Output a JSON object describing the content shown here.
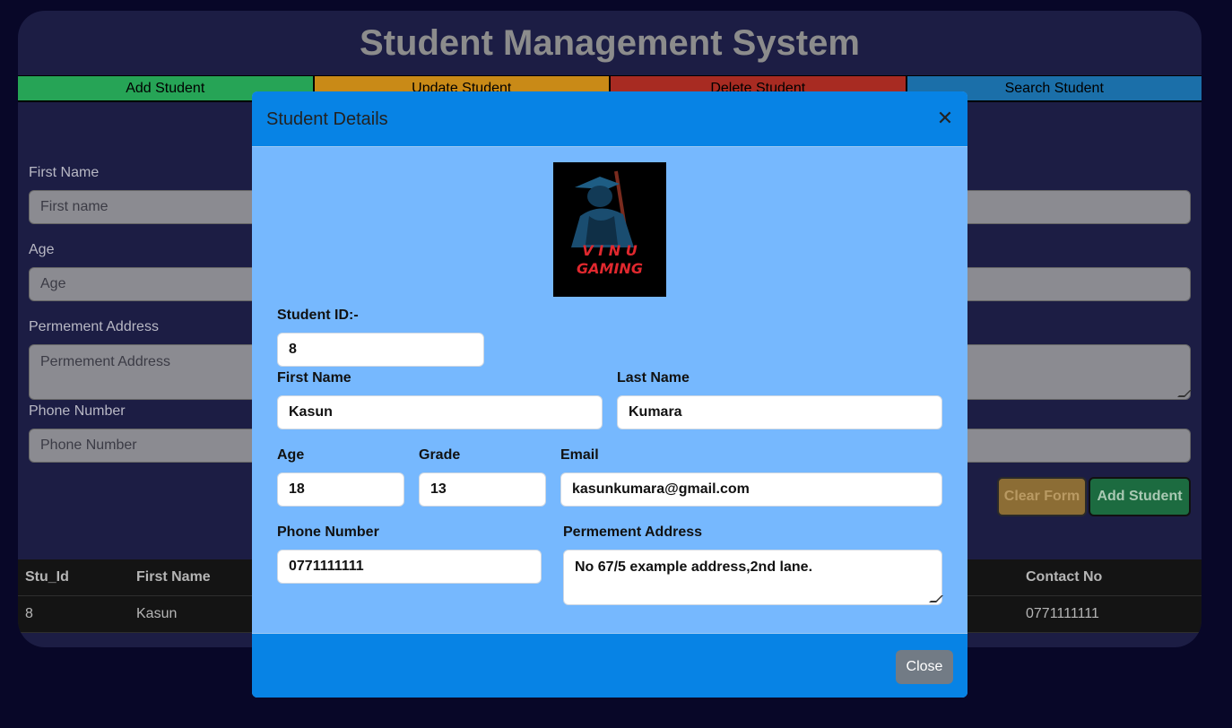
{
  "app": {
    "title": "Student Management System"
  },
  "tabs": [
    "Add Student",
    "Update Student",
    "Delete Student",
    "Search Student"
  ],
  "form": {
    "first_name_label": "First Name",
    "first_name_placeholder": "First name",
    "age_label": "Age",
    "age_placeholder": "Age",
    "address_label": "Permement Address",
    "address_placeholder": "Permement Address",
    "phone_label": "Phone Number",
    "phone_placeholder": "Phone Number",
    "clear_label": "Clear Form",
    "add_label": "Add Student"
  },
  "table": {
    "headers": {
      "id": "Stu_Id",
      "first": "First Name",
      "contact": "Contact No"
    },
    "rows": [
      {
        "id": "8",
        "first": "Kasun",
        "contact": "0771111111"
      }
    ]
  },
  "modal": {
    "title": "Student Details",
    "close_glyph": "✕",
    "logo_text": [
      "V I N U",
      "GAMING"
    ],
    "student_id_label": "Student ID:-",
    "student_id": "8",
    "first_name_label": "First Name",
    "first_name": "Kasun",
    "last_name_label": "Last Name",
    "last_name": "Kumara",
    "age_label": "Age",
    "age": "18",
    "grade_label": "Grade",
    "grade": "13",
    "email_label": "Email",
    "email": "kasunkumara@gmail.com",
    "phone_label": "Phone Number",
    "phone": "0771111111",
    "address_label": "Permement Address",
    "address": "No 67/5 example address,2nd lane.",
    "close_label": "Close"
  },
  "colors": {
    "background": "#080728",
    "panel": "#1c1d44",
    "modal_body": "#76b8fe",
    "modal_header": "#0783e5",
    "add_tab": "#26a456",
    "update_tab": "#c98a17",
    "delete_tab": "#a82b22",
    "search_tab": "#1b6fa9"
  }
}
